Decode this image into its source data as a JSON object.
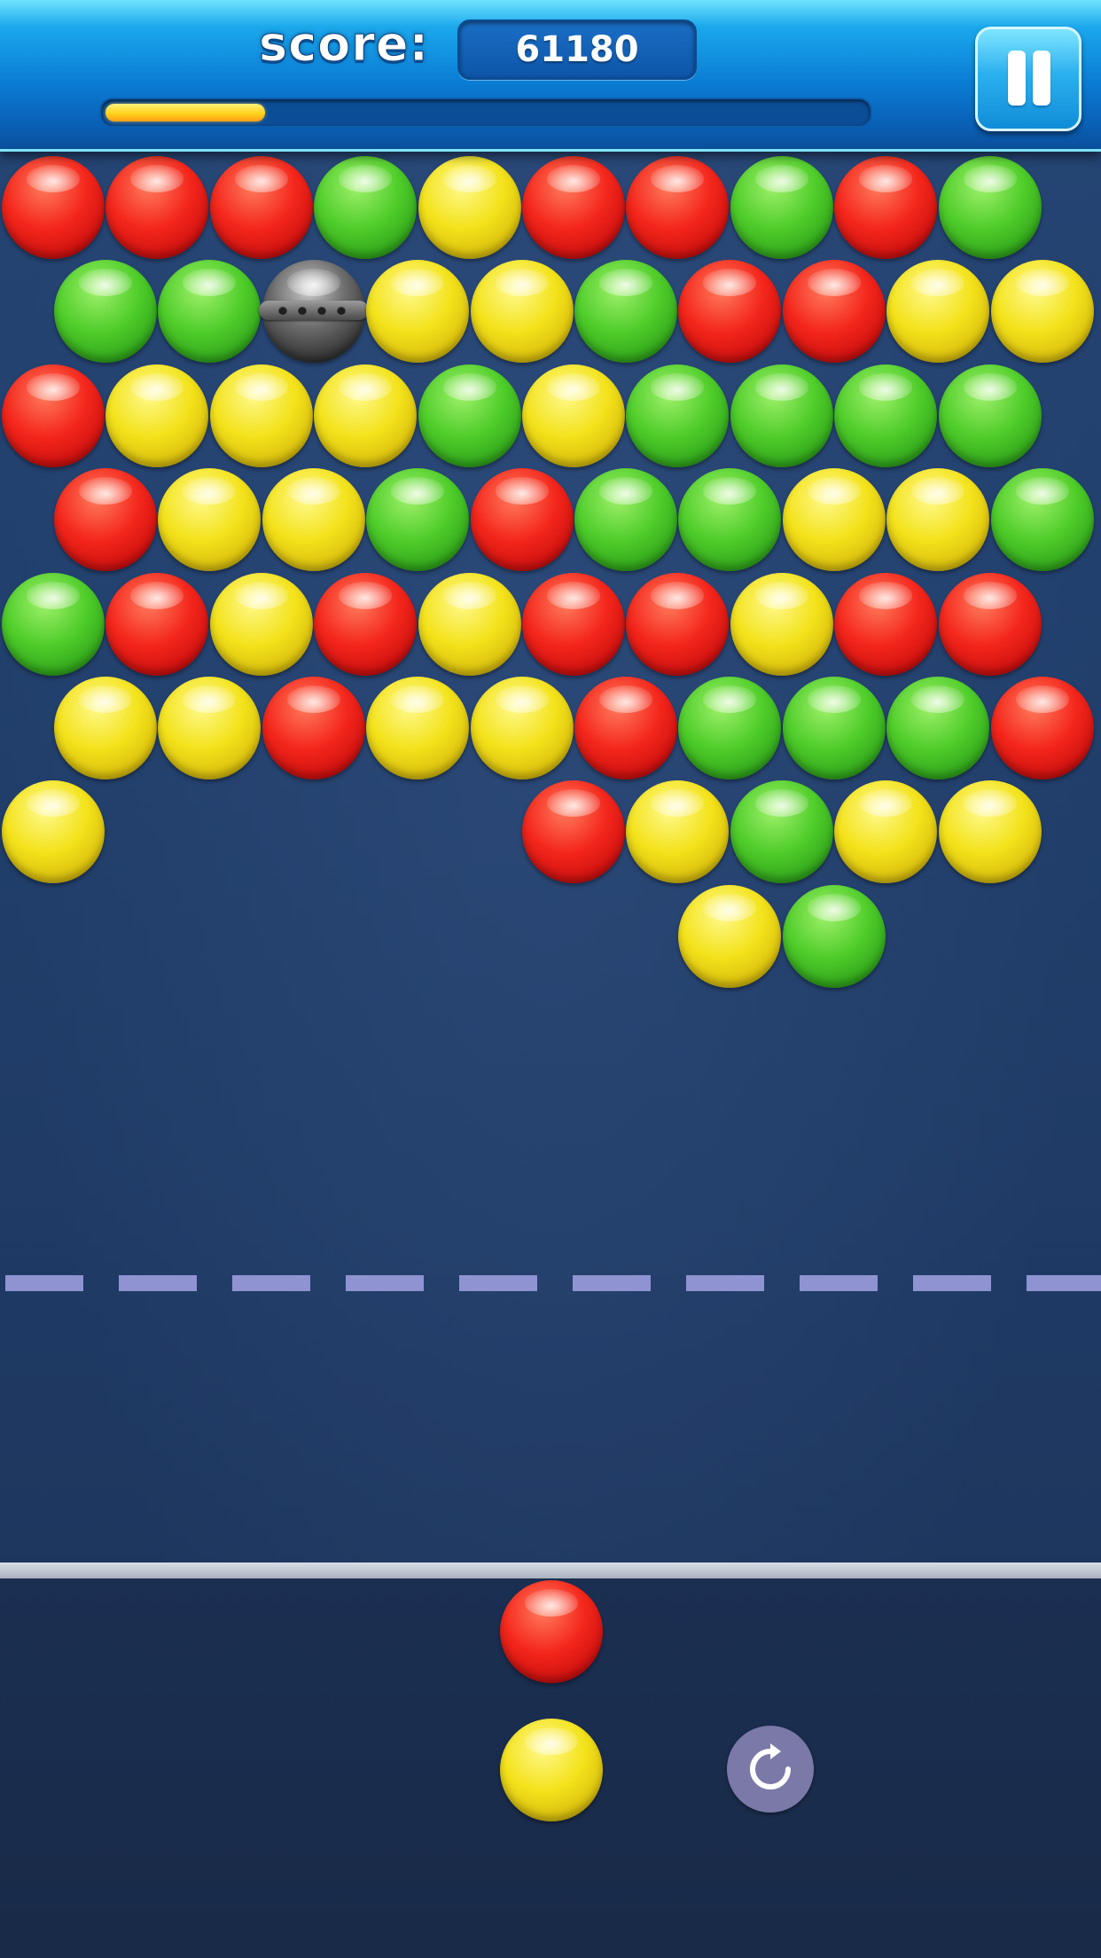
{
  "hud": {
    "score_label": "score:",
    "score_value": "61180",
    "progress_fraction": 0.21,
    "pause_icon": "pause-icon"
  },
  "colors": {
    "red": "#f4261b",
    "green": "#4fcd2a",
    "yellow": "#f3e21a",
    "bomb": "#5a5a5a",
    "background": "#1f3a62",
    "deadline": "#8f93d2"
  },
  "grid": {
    "rows": [
      {
        "offset": false,
        "cells": [
          "red",
          "red",
          "red",
          "green",
          "yellow",
          "red",
          "red",
          "green",
          "red",
          "green"
        ]
      },
      {
        "offset": true,
        "cells": [
          "green",
          "green",
          "bomb",
          "yellow",
          "yellow",
          "green",
          "red",
          "red",
          "yellow",
          "yellow"
        ]
      },
      {
        "offset": false,
        "cells": [
          "red",
          "yellow",
          "yellow",
          "yellow",
          "green",
          "yellow",
          "green",
          "green",
          "green",
          "green"
        ]
      },
      {
        "offset": true,
        "cells": [
          "red",
          "yellow",
          "yellow",
          "green",
          "red",
          "green",
          "green",
          "yellow",
          "yellow",
          "green"
        ]
      },
      {
        "offset": false,
        "cells": [
          "green",
          "red",
          "yellow",
          "red",
          "yellow",
          "red",
          "red",
          "yellow",
          "red",
          "red"
        ]
      },
      {
        "offset": true,
        "cells": [
          "yellow",
          "yellow",
          "red",
          "yellow",
          "yellow",
          "red",
          "green",
          "green",
          "green",
          "red"
        ]
      },
      {
        "offset": false,
        "cells": [
          "yellow",
          null,
          null,
          null,
          null,
          "red",
          "yellow",
          "green",
          "yellow",
          "yellow"
        ]
      },
      {
        "offset": true,
        "cells": [
          null,
          null,
          null,
          null,
          null,
          null,
          "yellow",
          "green",
          null,
          null
        ]
      }
    ]
  },
  "shooter": {
    "current_bubble": "red",
    "next_bubble": "yellow",
    "swap_icon": "rotate-arrow-icon"
  }
}
